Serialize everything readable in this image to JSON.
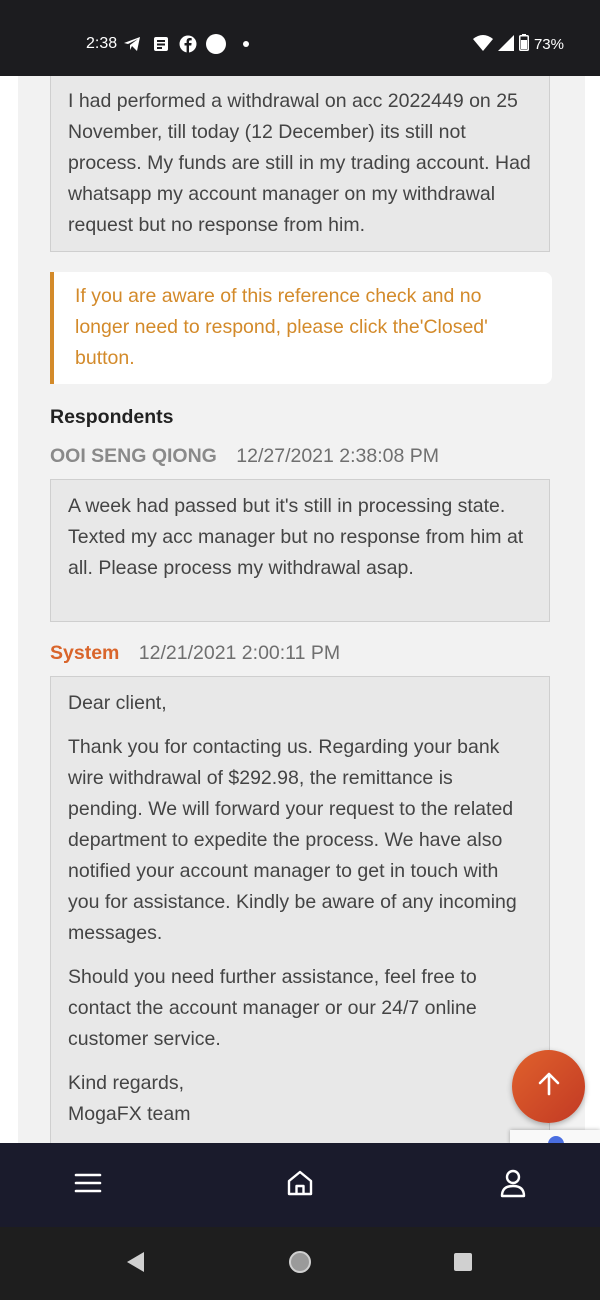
{
  "status_bar": {
    "time": "2:38",
    "battery": "73%",
    "icons": [
      "telegram-icon",
      "news-icon",
      "facebook-icon",
      "circle-notification-icon",
      "dot-icon",
      "wifi-icon",
      "signal-icon",
      "battery-icon"
    ]
  },
  "ticket": {
    "original_message": "I had performed a withdrawal on acc 2022449 on 25 November, till today (12 December) its still not process. My funds are still in my trading account. Had whatsapp my account manager on my withdrawal request but no response from him.",
    "notice": "If you are aware of this reference check and no longer need to respond, please click the'Closed' button.",
    "respondents_title": "Respondents",
    "responses": [
      {
        "name": "OOI SENG QIONG",
        "timestamp": "12/27/2021 2:38:08 PM",
        "paragraphs": [
          "A week had passed but it's still in processing state. Texted my acc manager but no response from him at all. Please process my withdrawal asap."
        ]
      },
      {
        "name": "System",
        "timestamp": "12/21/2021 2:00:11 PM",
        "paragraphs": [
          "Dear client,",
          "Thank you for contacting us. Regarding your bank wire withdrawal of $292.98, the remittance is pending. We will forward your request to the related department to expedite the process. We have also notified your account manager to get in touch with you for assistance. Kindly be aware of any incoming messages.",
          "Should you need further assistance, feel free to contact the account manager or our 24/7 online customer service.",
          "Kind regards,",
          "MogaFX team"
        ]
      }
    ]
  },
  "colors": {
    "accent_orange": "#d9652b",
    "notice_text": "#d38a2a",
    "nav_bg": "#1a1b2c"
  }
}
